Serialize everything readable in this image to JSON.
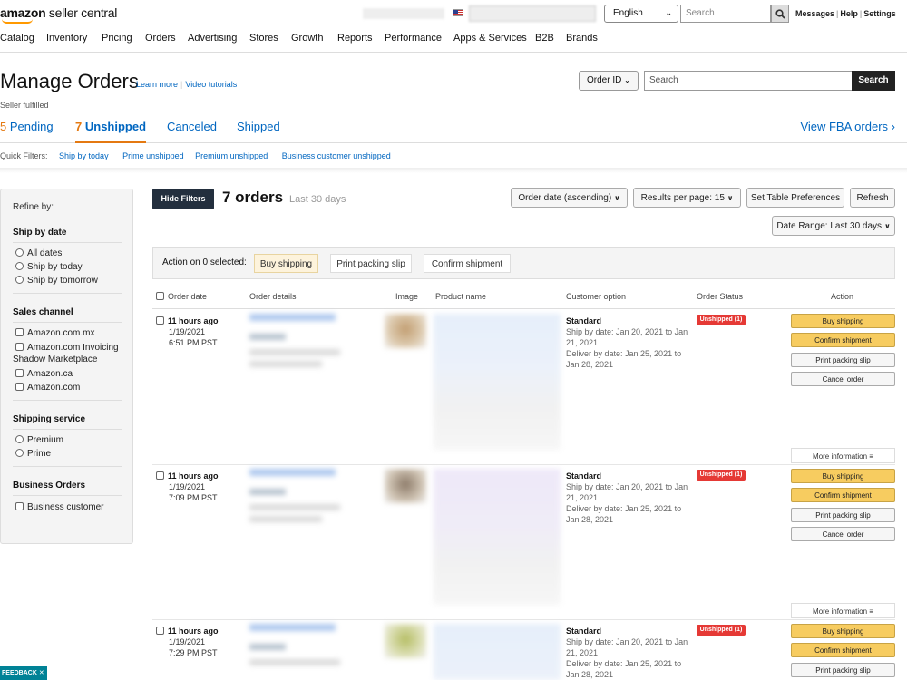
{
  "header": {
    "logo_bold": "amazon",
    "logo_light": " seller central",
    "language": "English",
    "search_placeholder": "Search",
    "links": [
      "Messages",
      "Help",
      "Settings"
    ]
  },
  "nav": [
    "Catalog",
    "Inventory",
    "Pricing",
    "Orders",
    "Advertising",
    "Stores",
    "Growth",
    "Reports",
    "Performance",
    "Apps & Services",
    "B2B",
    "Brands"
  ],
  "page": {
    "title": "Manage Orders",
    "learn_more": "Learn more",
    "video_tutorials": "Video tutorials",
    "order_id_select": "Order ID",
    "search_placeholder": "Search",
    "search_button": "Search",
    "fulfilled": "Seller fulfilled"
  },
  "tabs": [
    {
      "count": "5",
      "label": "Pending"
    },
    {
      "count": "7",
      "label": "Unshipped"
    },
    {
      "count": "",
      "label": "Canceled"
    },
    {
      "count": "",
      "label": "Shipped"
    }
  ],
  "view_fba": "View FBA orders",
  "quick_filters": {
    "label": "Quick Filters:",
    "items": [
      "Ship by today",
      "Prime unshipped",
      "Premium unshipped",
      "Business customer unshipped"
    ]
  },
  "sidebar": {
    "refine": "Refine by:",
    "ship_by_date": {
      "title": "Ship by date",
      "options": [
        "All dates",
        "Ship by today",
        "Ship by tomorrow"
      ]
    },
    "sales_channel": {
      "title": "Sales channel",
      "options": [
        "Amazon.com.mx",
        "Amazon.com Invoicing Shadow Marketplace",
        "Amazon.ca",
        "Amazon.com"
      ]
    },
    "shipping_service": {
      "title": "Shipping service",
      "options": [
        "Premium",
        "Prime"
      ]
    },
    "business_orders": {
      "title": "Business Orders",
      "options": [
        "Business customer"
      ]
    }
  },
  "toolbar": {
    "hide_filters": "Hide Filters",
    "orders_count": "7 orders",
    "orders_range": "Last 30 days",
    "sort": "Order date (ascending)",
    "results_per_page": "Results per page: 15",
    "table_prefs": "Set Table Preferences",
    "refresh": "Refresh",
    "date_range": "Date Range: Last 30 days"
  },
  "action_bar": {
    "label": "Action on 0 selected:",
    "buy_shipping": "Buy shipping",
    "print_packing": "Print packing slip",
    "confirm_shipment": "Confirm shipment"
  },
  "columns": [
    "Order date",
    "Order details",
    "Image",
    "Product name",
    "Customer option",
    "Order Status",
    "Action"
  ],
  "orders": [
    {
      "ago": "11 hours ago",
      "date": "1/19/2021",
      "time": "6:51 PM PST",
      "option": "Standard",
      "ship_by": "Ship by date: Jan 20, 2021 to Jan 21, 2021",
      "deliver_by": "Deliver by date: Jan 25, 2021 to Jan 28, 2021",
      "status": "Unshipped (1)"
    },
    {
      "ago": "11 hours ago",
      "date": "1/19/2021",
      "time": "7:09 PM PST",
      "option": "Standard",
      "ship_by": "Ship by date: Jan 20, 2021 to Jan 21, 2021",
      "deliver_by": "Deliver by date: Jan 25, 2021 to Jan 28, 2021",
      "status": "Unshipped (1)"
    },
    {
      "ago": "11 hours ago",
      "date": "1/19/2021",
      "time": "7:29 PM PST",
      "option": "Standard",
      "ship_by": "Ship by date: Jan 20, 2021 to Jan 21, 2021",
      "deliver_by": "Deliver by date: Jan 25, 2021 to Jan 28, 2021",
      "status": "Unshipped (1)"
    }
  ],
  "row_actions": {
    "buy_shipping": "Buy shipping",
    "confirm_shipment": "Confirm shipment",
    "print_packing": "Print packing slip",
    "cancel_order": "Cancel order",
    "more_info": "More information"
  },
  "feedback": "FEEDBACK",
  "colors": {
    "accent_orange": "#e47911",
    "link_blue": "#0066c0",
    "status_red": "#e53935",
    "button_yellow": "#f7cc60",
    "dark_button": "#232f3e"
  }
}
